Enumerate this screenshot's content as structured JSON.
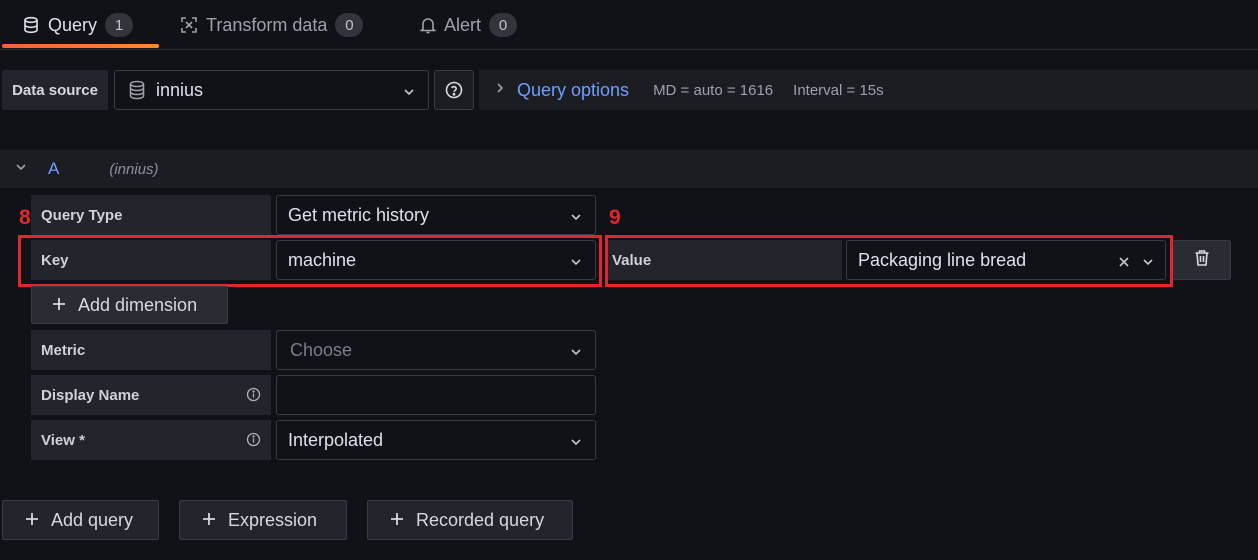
{
  "tabs": [
    {
      "label": "Query",
      "count": "1",
      "icon": "database-icon",
      "active": true
    },
    {
      "label": "Transform data",
      "count": "0",
      "icon": "transform-icon",
      "active": false
    },
    {
      "label": "Alert",
      "count": "0",
      "icon": "bell-icon",
      "active": false
    }
  ],
  "datasource": {
    "label": "Data source",
    "value": "innius"
  },
  "query_options": {
    "title": "Query options",
    "md": "MD = auto = 1616",
    "interval": "Interval = 15s"
  },
  "query": {
    "name": "A",
    "source": "(innius)",
    "fields": {
      "query_type": {
        "label": "Query Type",
        "value": "Get metric history"
      },
      "key": {
        "label": "Key",
        "value": "machine"
      },
      "value": {
        "label": "Value",
        "value": "Packaging line bread"
      },
      "add_dimension": "Add dimension",
      "metric": {
        "label": "Metric",
        "placeholder": "Choose"
      },
      "display_name": {
        "label": "Display Name",
        "value": ""
      },
      "view": {
        "label": "View *",
        "value": "Interpolated"
      }
    }
  },
  "annotations": [
    "8",
    "9"
  ],
  "bottom_buttons": {
    "add_query": "Add query",
    "expression": "Expression",
    "recorded_query": "Recorded query"
  },
  "colors": {
    "background": "#111217",
    "accent_blue": "#6e9fff",
    "annotation_red": "#e3262b",
    "tab_underline": "#f55f3e"
  }
}
